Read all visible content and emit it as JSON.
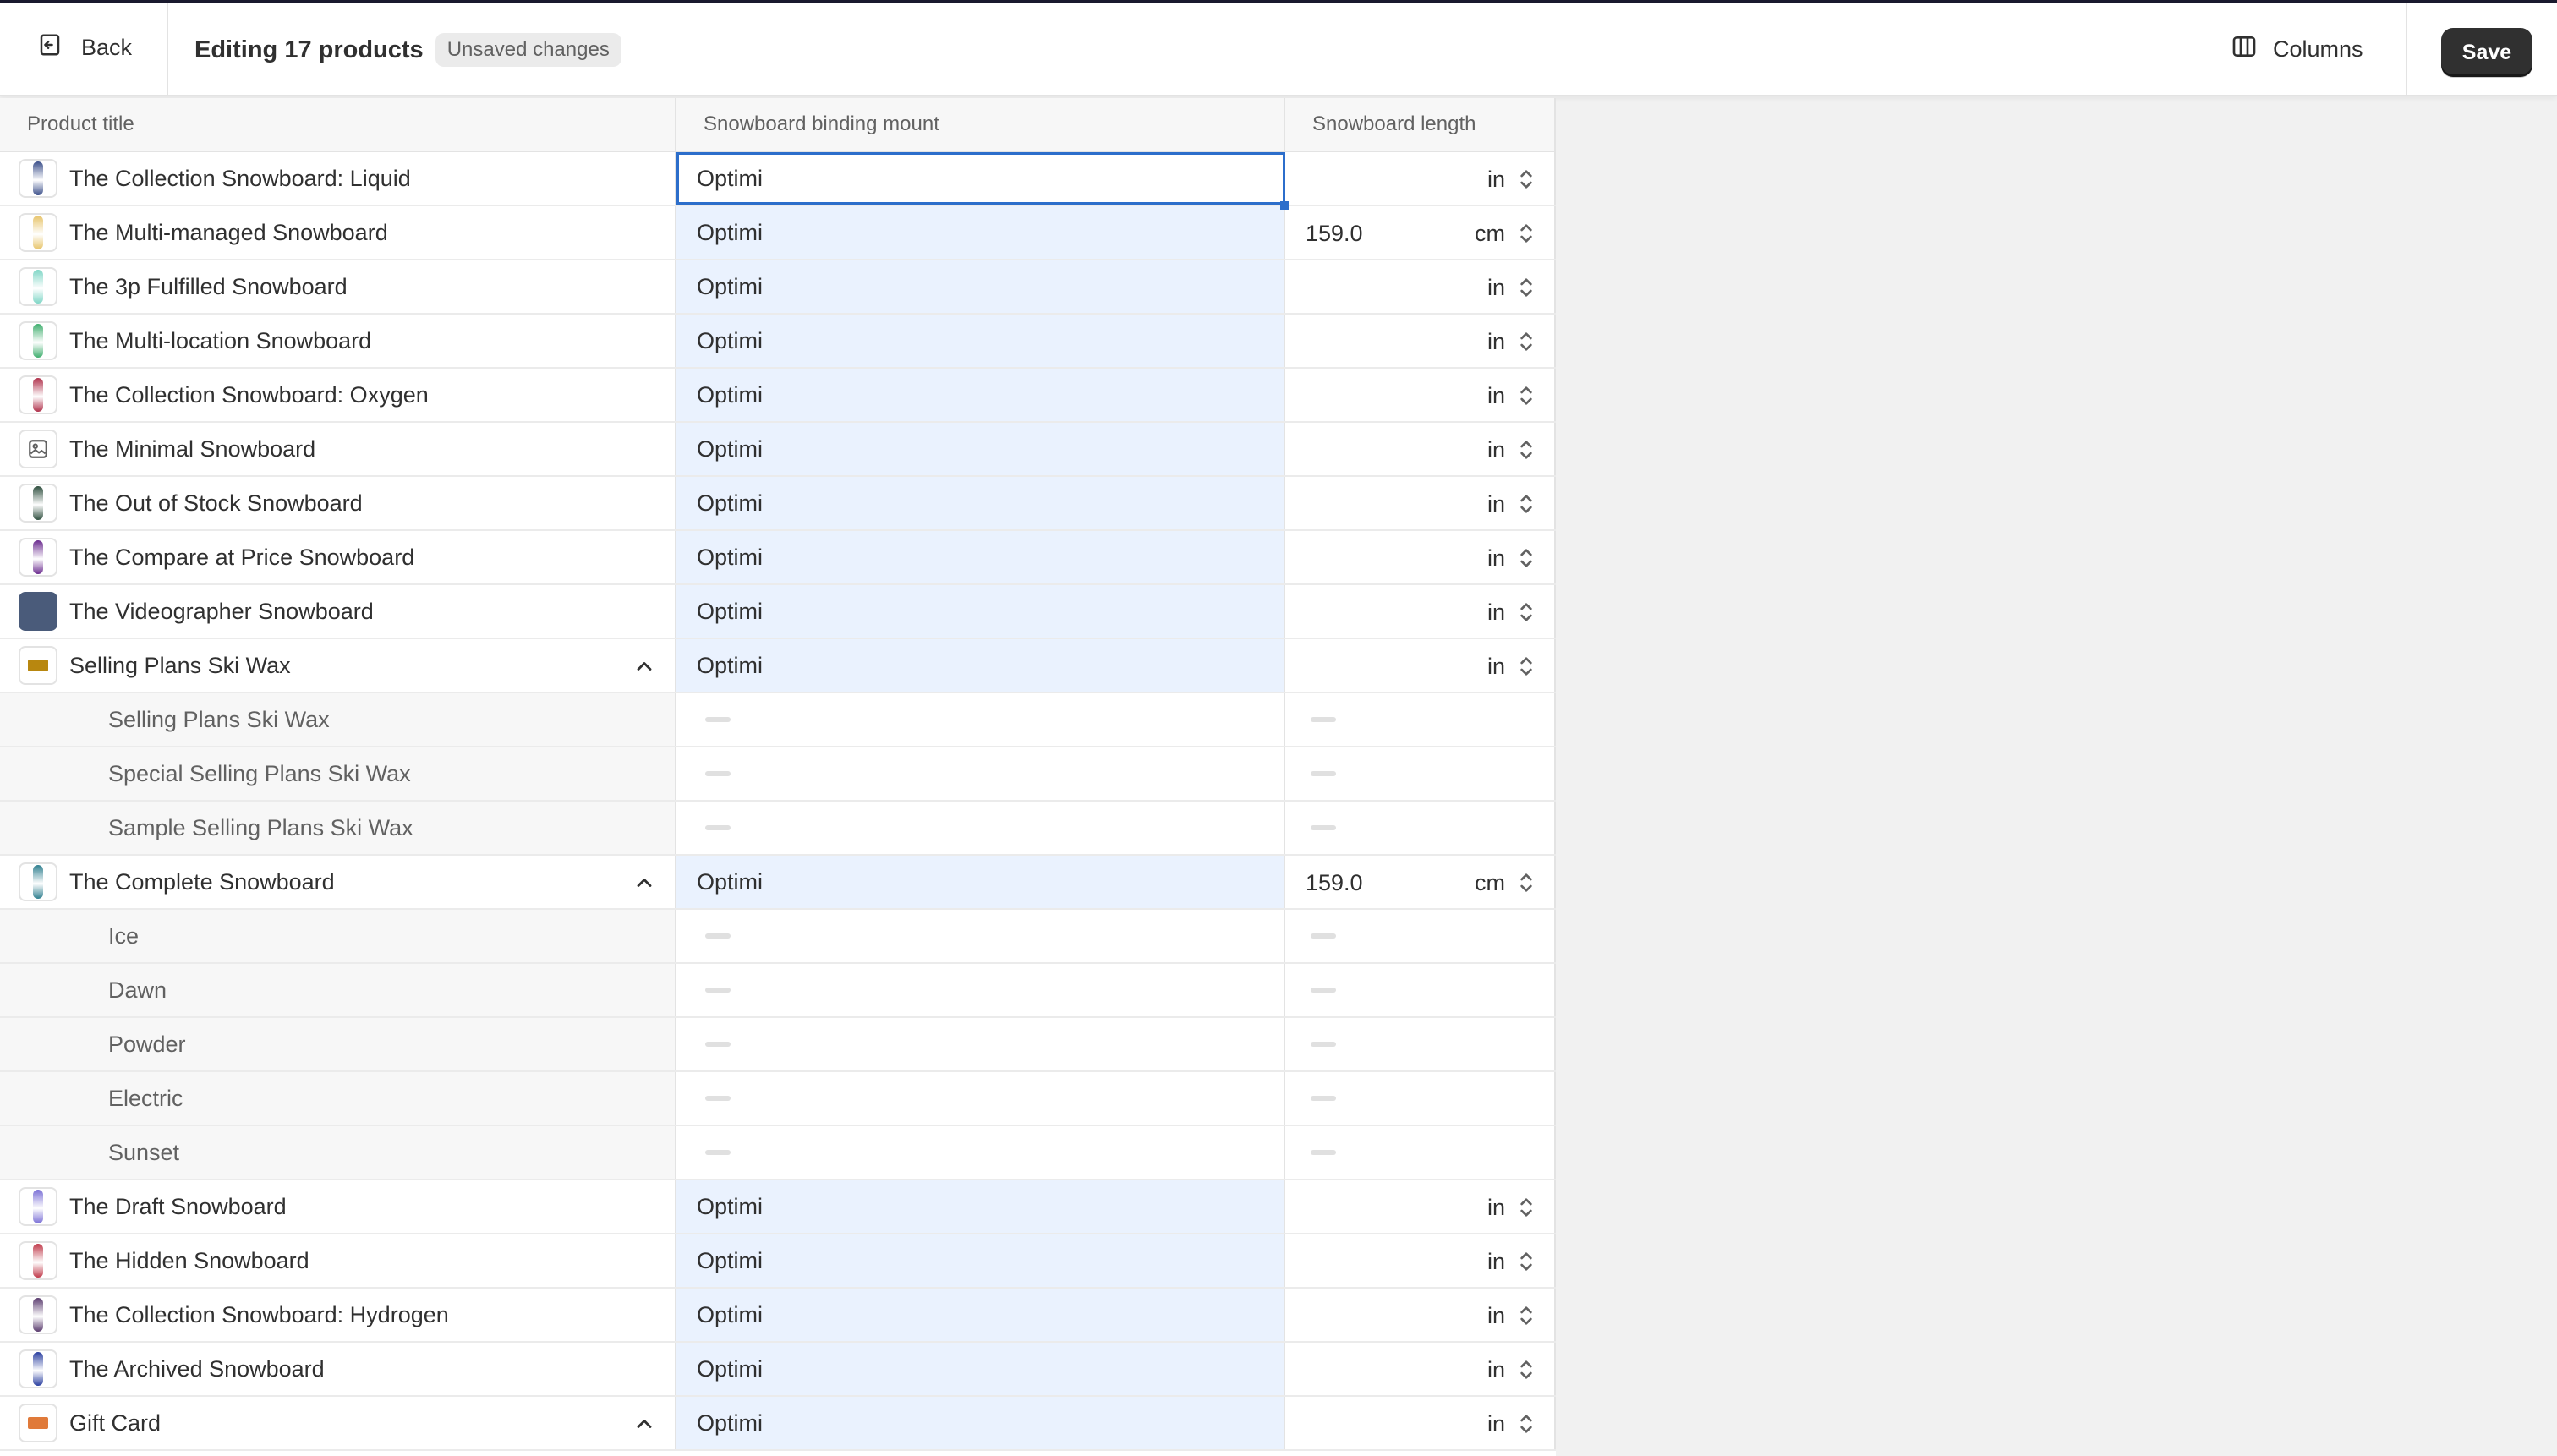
{
  "header": {
    "back_label": "Back",
    "title": "Editing 17 products",
    "badge": "Unsaved changes",
    "columns_label": "Columns",
    "save_label": "Save"
  },
  "table": {
    "columns": [
      "Product title",
      "Snowboard binding mount",
      "Snowboard length"
    ],
    "rows": [
      {
        "title": "The Collection Snowboard: Liquid",
        "mount": "Optimi",
        "length": "",
        "unit": "in",
        "type": "product",
        "thumb": "#3b4f8a"
      },
      {
        "title": "The Multi-managed Snowboard",
        "mount": "Optimi",
        "length": "159.0",
        "unit": "cm",
        "type": "product",
        "thumb": "#e7c46a"
      },
      {
        "title": "The 3p Fulfilled Snowboard",
        "mount": "Optimi",
        "length": "",
        "unit": "in",
        "type": "product",
        "thumb": "#7fd6c6"
      },
      {
        "title": "The Multi-location Snowboard",
        "mount": "Optimi",
        "length": "",
        "unit": "in",
        "type": "product",
        "thumb": "#3fae6e"
      },
      {
        "title": "The Collection Snowboard: Oxygen",
        "mount": "Optimi",
        "length": "",
        "unit": "in",
        "type": "product",
        "thumb": "#b0304a"
      },
      {
        "title": "The Minimal Snowboard",
        "mount": "Optimi",
        "length": "",
        "unit": "in",
        "type": "product-noimage",
        "thumb": ""
      },
      {
        "title": "The Out of Stock Snowboard",
        "mount": "Optimi",
        "length": "",
        "unit": "in",
        "type": "product",
        "thumb": "#2f4f3f"
      },
      {
        "title": "The Compare at Price Snowboard",
        "mount": "Optimi",
        "length": "",
        "unit": "in",
        "type": "product",
        "thumb": "#6b2b8f"
      },
      {
        "title": "The Videographer Snowboard",
        "mount": "Optimi",
        "length": "",
        "unit": "in",
        "type": "product-photo",
        "thumb": "#4a5b7a"
      },
      {
        "title": "Selling Plans Ski Wax",
        "mount": "Optimi",
        "length": "",
        "unit": "in",
        "type": "parent",
        "thumb": "#b8870f"
      },
      {
        "title": "Selling Plans Ski Wax",
        "type": "variant"
      },
      {
        "title": "Special Selling Plans Ski Wax",
        "type": "variant"
      },
      {
        "title": "Sample Selling Plans Ski Wax",
        "type": "variant"
      },
      {
        "title": "The Complete Snowboard",
        "mount": "Optimi",
        "length": "159.0",
        "unit": "cm",
        "type": "parent",
        "thumb": "#2f7f8f"
      },
      {
        "title": "Ice",
        "type": "variant"
      },
      {
        "title": "Dawn",
        "type": "variant"
      },
      {
        "title": "Powder",
        "type": "variant"
      },
      {
        "title": "Electric",
        "type": "variant"
      },
      {
        "title": "Sunset",
        "type": "variant"
      },
      {
        "title": "The Draft Snowboard",
        "mount": "Optimi",
        "length": "",
        "unit": "in",
        "type": "product",
        "thumb": "#7a6fd6"
      },
      {
        "title": "The Hidden Snowboard",
        "mount": "Optimi",
        "length": "",
        "unit": "in",
        "type": "product",
        "thumb": "#c0394a"
      },
      {
        "title": "The Collection Snowboard: Hydrogen",
        "mount": "Optimi",
        "length": "",
        "unit": "in",
        "type": "product",
        "thumb": "#5a3b6e"
      },
      {
        "title": "The Archived Snowboard",
        "mount": "Optimi",
        "length": "",
        "unit": "in",
        "type": "product",
        "thumb": "#2a3fa0"
      },
      {
        "title": "Gift Card",
        "mount": "Optimi",
        "length": "",
        "unit": "in",
        "type": "parent",
        "thumb": "#e07a3a"
      }
    ]
  },
  "colors": {
    "accent": "#2c6ecb",
    "highlight": "#eaf2fe",
    "save_bg": "#303030"
  }
}
